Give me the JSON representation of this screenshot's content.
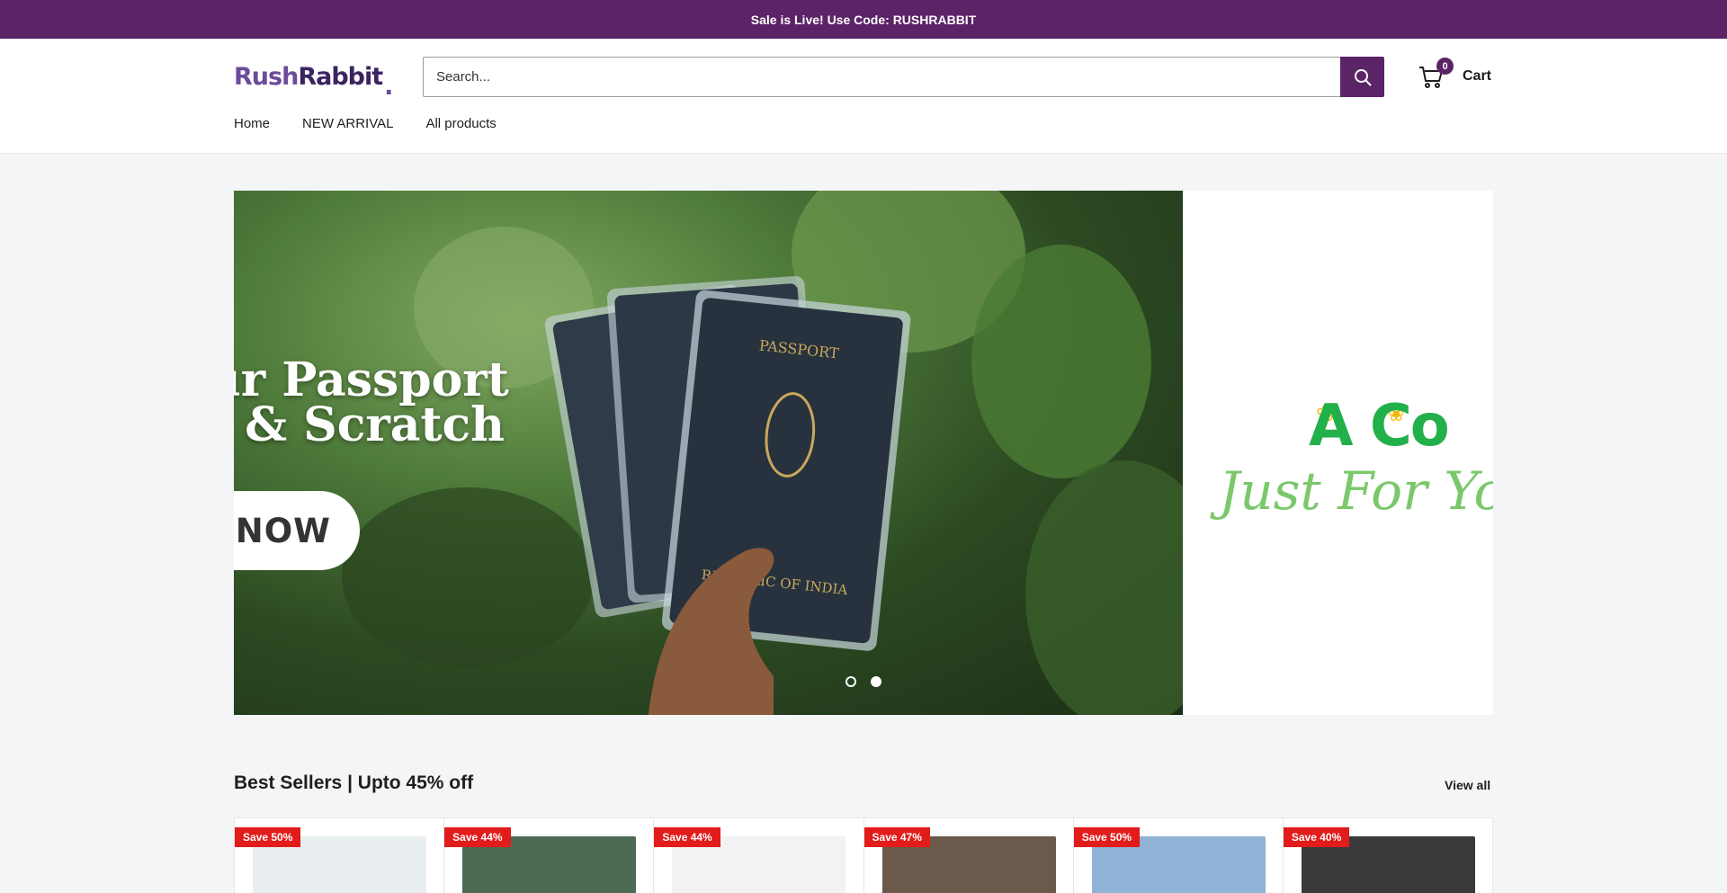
{
  "announcement": {
    "text": "Sale is Live! Use Code: RUSHRABBIT"
  },
  "header": {
    "logo": {
      "part1": "Rush",
      "part2": "Rabbit",
      "dot": "."
    },
    "search": {
      "placeholder": "Search..."
    },
    "cart": {
      "count": "0",
      "label": "Cart"
    }
  },
  "nav": {
    "items": [
      "Home",
      "NEW ARRIVAL",
      "All products"
    ]
  },
  "hero": {
    "slides": [
      {
        "title": "ur Passport\nt & Scratch",
        "button": "P NOW"
      },
      {
        "headline": "A Co",
        "script": "Just For You"
      }
    ],
    "active_slide": 2,
    "slide_count": 2
  },
  "best_sellers": {
    "title": "Best Sellers | Upto 45% off",
    "view_all": "View all",
    "products": [
      {
        "badge": "Save 50%",
        "thumb_color": "#e9eef1"
      },
      {
        "badge": "Save 44%",
        "thumb_color": "#4d6a55"
      },
      {
        "badge": "Save 44%",
        "thumb_color": "#f2f2f2"
      },
      {
        "badge": "Save 47%",
        "thumb_color": "#6b5a4b"
      },
      {
        "badge": "Save 50%",
        "thumb_color": "#8fb3d6"
      },
      {
        "badge": "Save 40%",
        "thumb_color": "#3a3a3a"
      }
    ]
  },
  "colors": {
    "brand": "#5b2467",
    "sale_badge": "#e21b1b"
  }
}
